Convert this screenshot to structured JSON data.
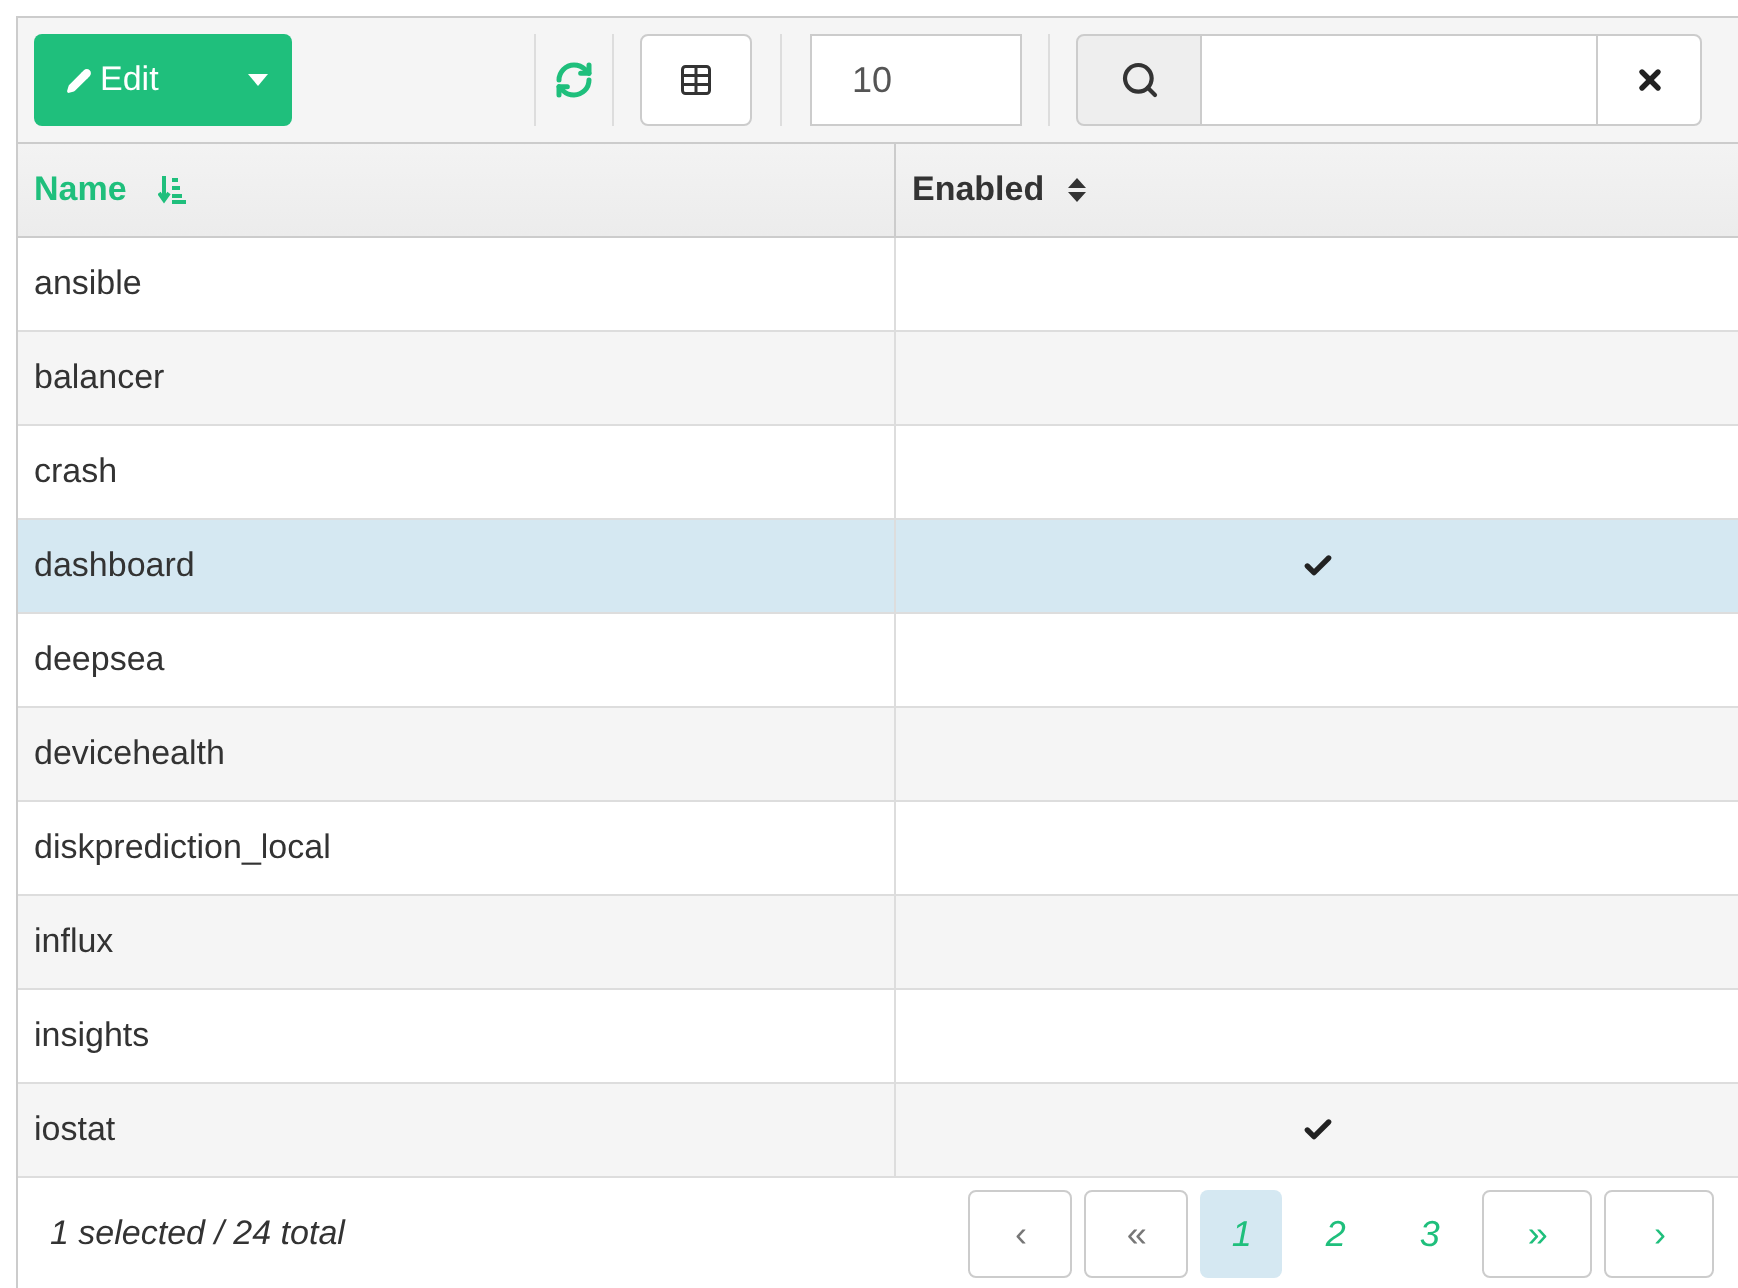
{
  "toolbar": {
    "edit_button": "Edit",
    "page_size": "10"
  },
  "table": {
    "columns": [
      {
        "label": "Name",
        "sorted": true
      },
      {
        "label": "Enabled",
        "sorted": false
      }
    ],
    "rows": [
      {
        "name": "ansible",
        "enabled": false,
        "selected": false
      },
      {
        "name": "balancer",
        "enabled": false,
        "selected": false
      },
      {
        "name": "crash",
        "enabled": false,
        "selected": false
      },
      {
        "name": "dashboard",
        "enabled": true,
        "selected": true
      },
      {
        "name": "deepsea",
        "enabled": false,
        "selected": false
      },
      {
        "name": "devicehealth",
        "enabled": false,
        "selected": false
      },
      {
        "name": "diskprediction_local",
        "enabled": false,
        "selected": false
      },
      {
        "name": "influx",
        "enabled": false,
        "selected": false
      },
      {
        "name": "insights",
        "enabled": false,
        "selected": false
      },
      {
        "name": "iostat",
        "enabled": true,
        "selected": false
      }
    ]
  },
  "footer": {
    "summary": "1 selected / 24 total",
    "pagination": [
      {
        "label": "‹",
        "kind": "nav",
        "selected": false
      },
      {
        "label": "«",
        "kind": "nav",
        "selected": false
      },
      {
        "label": "1",
        "kind": "page",
        "selected": true
      },
      {
        "label": "2",
        "kind": "page",
        "selected": false
      },
      {
        "label": "3",
        "kind": "page",
        "selected": false
      },
      {
        "label": "»",
        "kind": "nav",
        "selected": false
      },
      {
        "label": "›",
        "kind": "nav",
        "selected": false
      }
    ]
  }
}
